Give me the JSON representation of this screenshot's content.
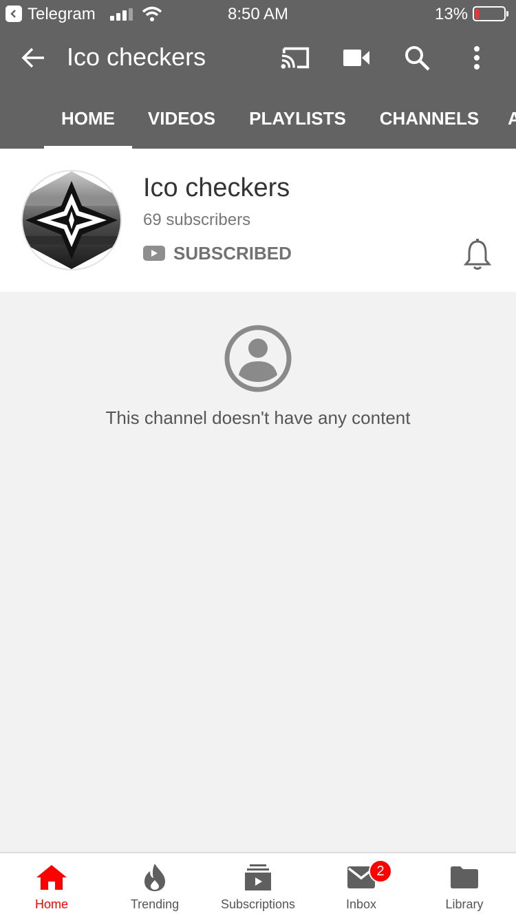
{
  "status_bar": {
    "app": "Telegram",
    "time": "8:50 AM",
    "battery": "13%",
    "battery_level": 0.13,
    "signal_bars": 3
  },
  "app_bar": {
    "title": "Ico checkers",
    "icons": [
      "back-arrow-icon",
      "cast-icon",
      "video-camera-icon",
      "search-icon",
      "more-vert-icon"
    ]
  },
  "tabs": [
    {
      "label": "HOME",
      "active": true
    },
    {
      "label": "VIDEOS"
    },
    {
      "label": "PLAYLISTS"
    },
    {
      "label": "CHANNELS"
    },
    {
      "label": "A"
    }
  ],
  "channel": {
    "name": "Ico checkers",
    "subscribers": "69 subscribers",
    "subscribe_state": "SUBSCRIBED"
  },
  "empty_state": {
    "message": "This channel doesn't have any content"
  },
  "bottom_nav": [
    {
      "label": "Home",
      "icon": "home-icon",
      "active": true
    },
    {
      "label": "Trending",
      "icon": "flame-icon"
    },
    {
      "label": "Subscriptions",
      "icon": "subscriptions-icon"
    },
    {
      "label": "Inbox",
      "icon": "mail-icon",
      "badge": "2"
    },
    {
      "label": "Library",
      "icon": "folder-icon"
    }
  ],
  "colors": {
    "header_gray": "#636363",
    "accent_red": "#ff0000",
    "background": "#f2f2f2"
  }
}
